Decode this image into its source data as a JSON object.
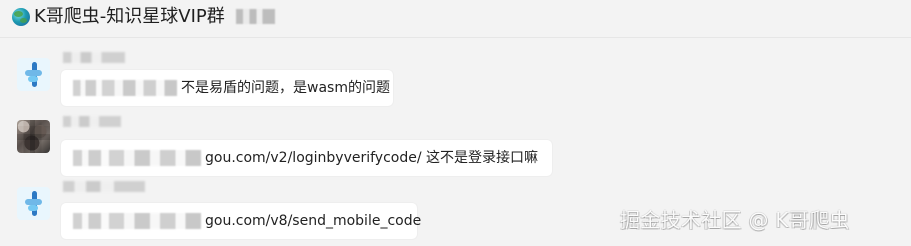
{
  "header": {
    "title": "K哥爬虫-知识星球VIP群",
    "icon": "globe-icon"
  },
  "messages": [
    {
      "text": "不是易盾的问题，是wasm的问题"
    },
    {
      "text": "gou.com/v2/loginbyverifycode/   这不是登录接口嘛"
    },
    {
      "text": "gou.com/v8/send_mobile_code"
    }
  ],
  "watermark": {
    "text": "掘金技术社区 @ K哥爬虫"
  },
  "colors": {
    "page_background": "#f3f3f3",
    "bubble_background": "#ffffff",
    "text_primary": "#222222",
    "avatar_blue": "#2c79c4",
    "avatar_light_blue": "#74c8f2"
  }
}
